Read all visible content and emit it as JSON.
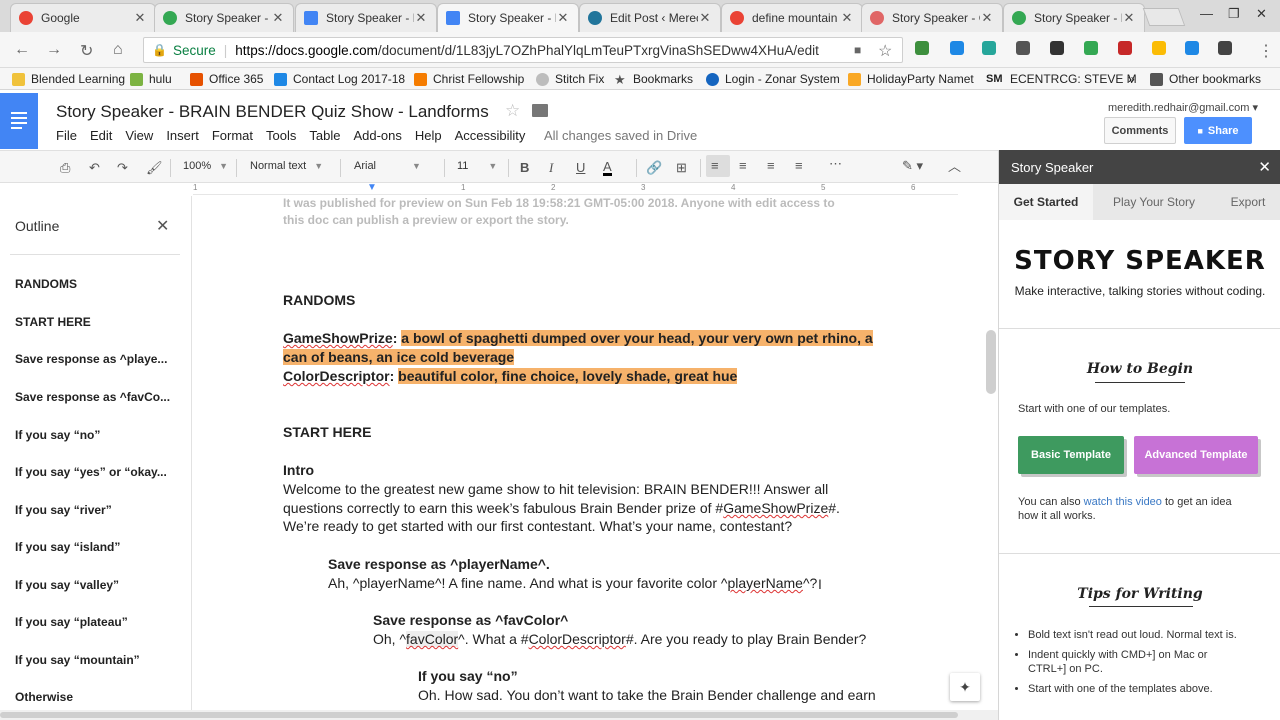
{
  "browser": {
    "tabs": [
      {
        "title": "Google",
        "color": "#ea4335",
        "active": false
      },
      {
        "title": "Story Speaker - E",
        "color": "#34a853",
        "active": false
      },
      {
        "title": "Story Speaker - E",
        "color": "#4285f4",
        "active": false
      },
      {
        "title": "Story Speaker - E",
        "color": "#4285f4",
        "active": true
      },
      {
        "title": "Edit Post ‹ Merec",
        "color": "#21759b",
        "active": false
      },
      {
        "title": "define mountain",
        "color": "#ea4335",
        "active": false
      },
      {
        "title": "Story Speaker - C",
        "color": "#e06666",
        "active": false
      },
      {
        "title": "Story Speaker - E",
        "color": "#34a853",
        "active": false
      }
    ],
    "secure_label": "Secure",
    "url_host": "https://docs.google.com",
    "url_path": "/document/d/1L83jyL7OZhPhalYlqLmTeuPTxrgVinaShSEDww4XHuA/edit",
    "bookmarks": [
      {
        "label": "Blended Learning",
        "color": "#f0c23b"
      },
      {
        "label": "hulu",
        "color": "#7cb342"
      },
      {
        "label": "Office 365",
        "color": "#e65100"
      },
      {
        "label": "Contact Log 2017-18",
        "color": "#1e88e5"
      },
      {
        "label": "Christ Fellowship",
        "color": "#f57c00"
      },
      {
        "label": "Stitch Fix",
        "color": "#bdbdbd"
      },
      {
        "label": "Bookmarks",
        "color": "#555555"
      },
      {
        "label": "Login - Zonar System",
        "color": "#1565c0"
      },
      {
        "label": "HolidayParty Namet",
        "color": "#f9a825"
      },
      {
        "label": "ECENTRCG: STEVE M",
        "color": "#222222"
      },
      {
        "label": "»",
        "color": ""
      },
      {
        "label": "Other bookmarks",
        "color": "#555555"
      }
    ]
  },
  "docs": {
    "title": "Story Speaker - BRAIN BENDER Quiz Show - Landforms",
    "menus": [
      "File",
      "Edit",
      "View",
      "Insert",
      "Format",
      "Tools",
      "Table",
      "Add-ons",
      "Help",
      "Accessibility"
    ],
    "save_status": "All changes saved in Drive",
    "account_email": "meredith.redhair@gmail.com",
    "comments_label": "Comments",
    "share_label": "Share",
    "toolbar": {
      "zoom": "100%",
      "style": "Normal text",
      "font": "Arial",
      "size": "11"
    }
  },
  "outline": {
    "title": "Outline",
    "items": [
      "RANDOMS",
      "START HERE",
      "Save response as ^playe...",
      "Save response as ^favCo...",
      "If you say “no”",
      "If you say “yes” or “okay...",
      "If you say “river”",
      "If you say “island”",
      "If you say “valley”",
      "If you say “plateau”",
      "If you say “mountain”",
      "Otherwise"
    ]
  },
  "document": {
    "faded_line1": "It was published for preview on Sun Feb 18 19:58:21 GMT-05:00 2018. Anyone with edit access to",
    "faded_line2": "this doc can publish a preview or export the story.",
    "randoms_heading": "RANDOMS",
    "prize_label": "GameShowPrize",
    "prize_text_1": "a bowl of spaghetti dumped over your head, your very own pet rhino, a",
    "prize_text_2": "can of beans, an ice cold beverage",
    "color_label": "ColorDescriptor",
    "color_text": "beautiful color, fine choice, lovely shade, great hue",
    "start_heading": "START HERE",
    "intro_heading": "Intro",
    "intro_line1": "Welcome to the greatest new game show to hit television: BRAIN BENDER!!! Answer all",
    "intro_line2a": "questions correctly to earn this week’s fabulous Brain Bender prize of #",
    "intro_line2b": "GameShowPrize",
    "intro_line2c": "#.",
    "intro_line3": "We’re ready to get started with our first contestant. What’s your name, contestant?",
    "save_player": "Save response as ^playerName^.",
    "player_line_a": "Ah, ^playerName^! A fine name. And what is your favorite color ^",
    "player_line_b": "playerName",
    "player_line_c": "^?",
    "save_color": "Save response as ^favColor^",
    "color_line_a": "Oh, ^",
    "color_line_b": "favColor",
    "color_line_c": "^. What a #",
    "color_line_d": "ColorDescriptor",
    "color_line_e": "#. Are you ready to play Brain Bender?",
    "if_no": "If you say “no”",
    "no_line": "Oh. How sad. You don’t want to take the Brain Bender challenge and earn"
  },
  "sidebar": {
    "title": "Story Speaker",
    "tabs": [
      "Get Started",
      "Play Your Story",
      "Export"
    ],
    "logo": "STORY SPEAKER",
    "tagline": "Make interactive, talking stories without coding.",
    "how_title": "How to Begin",
    "how_text": "Start with one of our templates.",
    "basic_template": "Basic Template",
    "advanced_template": "Advanced Template",
    "video_pre": "You can also ",
    "video_link": "watch this video",
    "video_post": " to get an idea",
    "video_line2": "how it all works.",
    "tips_title": "Tips for Writing",
    "tips": [
      "Bold text isn't read out loud. Normal text is.",
      "Indent quickly with CMD+] on Mac or",
      "CTRL+] on PC.",
      "Start with one of the templates above."
    ]
  }
}
